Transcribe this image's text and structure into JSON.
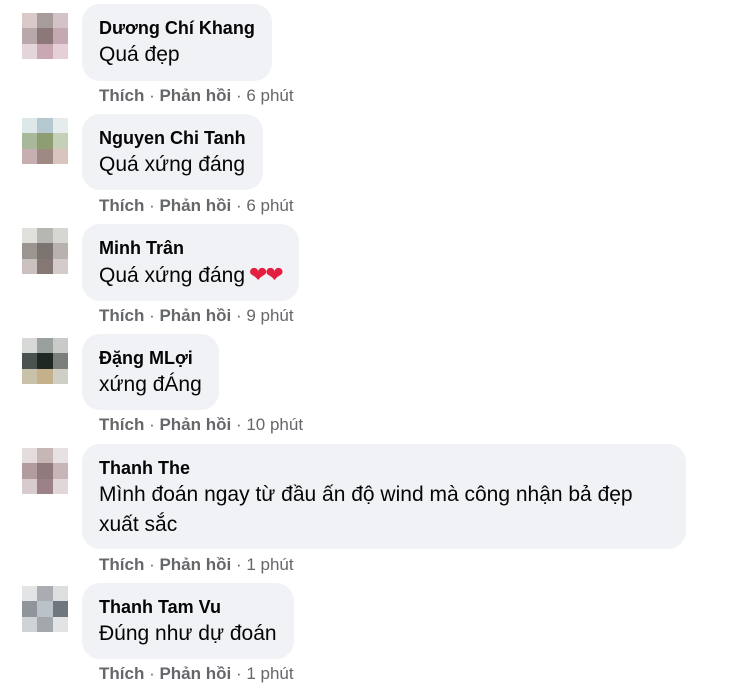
{
  "comments": [
    {
      "author": "Dương Chí Khang",
      "text": "Quá đẹp",
      "emoji": "",
      "like": "Thích",
      "reply": "Phản hồi",
      "time": "6 phút",
      "avatar_colors": [
        "#d9c9c9",
        "#a89b9b",
        "#d3c2c7",
        "#b8a8ab",
        "#8c7878",
        "#c4a9b3",
        "#e3d5da",
        "#c9a8b3",
        "#e6cfd6"
      ]
    },
    {
      "author": "Nguyen Chi Tanh",
      "text": "Quá xứng đáng",
      "emoji": "",
      "like": "Thích",
      "reply": "Phản hồi",
      "time": "6 phút",
      "avatar_colors": [
        "#dfe8e8",
        "#b6c8cf",
        "#e6ecec",
        "#a9b89a",
        "#8e9e72",
        "#c6d0b8",
        "#c7aeb0",
        "#9e8a82",
        "#d9c4c0"
      ]
    },
    {
      "author": "Minh Trân",
      "text": "Quá xứng đáng",
      "emoji": "❤❤",
      "like": "Thích",
      "reply": "Phản hồi",
      "time": "9 phút",
      "avatar_colors": [
        "#e0e0dc",
        "#b7b7b2",
        "#d6d6d2",
        "#9b9590",
        "#7b7470",
        "#b8b2ae",
        "#c9c0bf",
        "#857874",
        "#d4cccb"
      ]
    },
    {
      "author": "Đặng MLợi",
      "text": "xứng đÁng",
      "emoji": "",
      "like": "Thích",
      "reply": "Phản hồi",
      "time": "10 phút",
      "avatar_colors": [
        "#d7d9d6",
        "#9aa09d",
        "#c8cbc8",
        "#4b5350",
        "#202824",
        "#7a7f79",
        "#c9c2aa",
        "#c4b08a",
        "#cfcfc6"
      ]
    },
    {
      "author": "Thanh The",
      "text": "Mình đoán ngay từ đầu ấn độ wind mà công nhận bả đẹp xuất sắc",
      "emoji": "",
      "like": "Thích",
      "reply": "Phản hồi",
      "time": "1 phút",
      "avatar_colors": [
        "#e4dcdc",
        "#c6b6b6",
        "#e8e1e1",
        "#b29c9f",
        "#907a7e",
        "#c7b5b8",
        "#d8cbcd",
        "#9c8286",
        "#e1d6d8"
      ]
    },
    {
      "author": "Thanh Tam Vu",
      "text": "Đúng như dự đoán",
      "emoji": "",
      "like": "Thích",
      "reply": "Phản hồi",
      "time": "1 phút",
      "avatar_colors": [
        "#e3e4e5",
        "#a9acb0",
        "#dcdedf",
        "#8f959b",
        "#b9c2c8",
        "#6f767d",
        "#cfd3d6",
        "#a3a8ad",
        "#e1e3e4"
      ]
    }
  ]
}
